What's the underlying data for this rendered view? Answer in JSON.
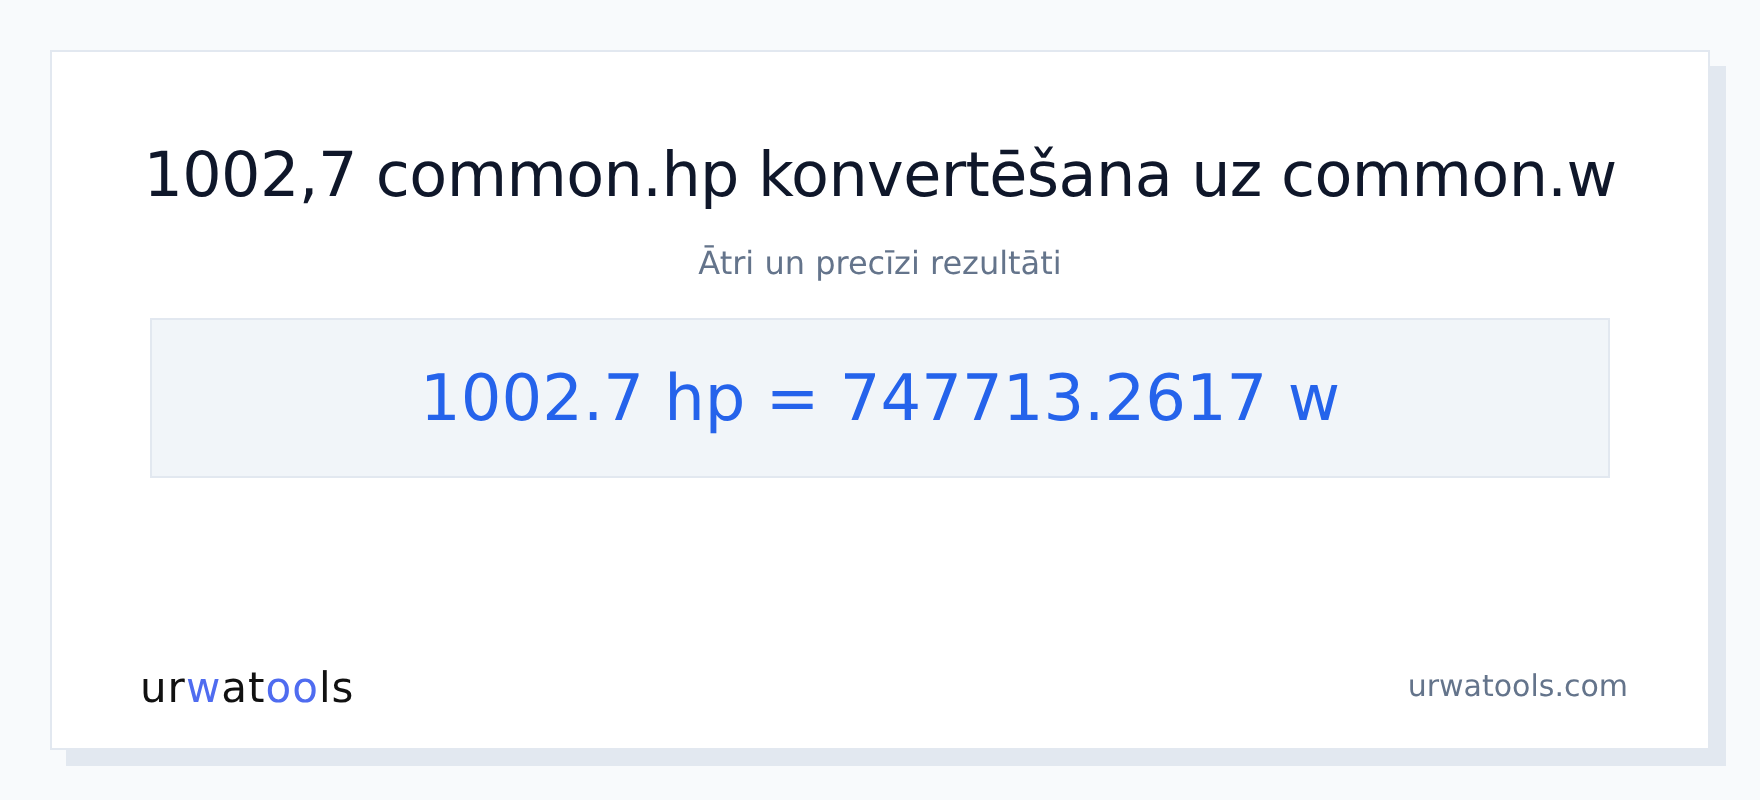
{
  "title": "1002,7 common.hp konvertēšana uz common.w",
  "subtitle": "Ātri un precīzi rezultāti",
  "result": "1002.7 hp = 747713.2617 w",
  "logo": {
    "parts": [
      {
        "text": "ur",
        "accent": false
      },
      {
        "text": "w",
        "accent": true
      },
      {
        "text": "at",
        "accent": false
      },
      {
        "text": "oo",
        "accent": true
      },
      {
        "text": "ls",
        "accent": false
      }
    ]
  },
  "site": "urwatools.com"
}
